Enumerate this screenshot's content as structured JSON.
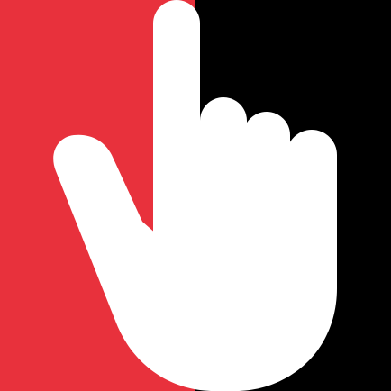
{
  "icon": {
    "name": "pointing-hand-icon",
    "colors": {
      "left_background": "#E8313C",
      "right_background": "#000000",
      "hand": "#FFFFFF"
    }
  }
}
